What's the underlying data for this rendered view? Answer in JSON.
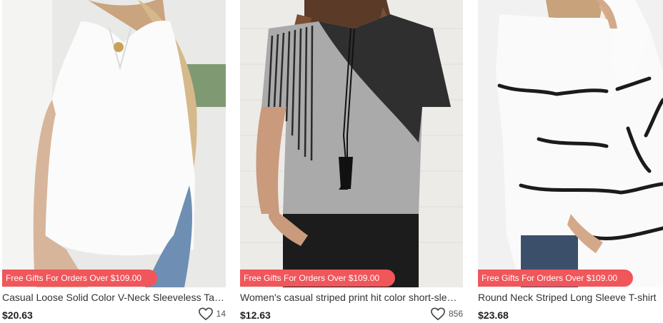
{
  "promo_text": "Free Gifts For Orders Over $109.00",
  "products": [
    {
      "title": "Casual Loose Solid Color V-Neck Sleeveless Tank Top",
      "price": "$20.63",
      "favorites": "14",
      "image_icon": "white-sleeveless-top-photo"
    },
    {
      "title": "Women's casual striped print hit color short-sleeve T-shirt",
      "price": "$12.63",
      "favorites": "856",
      "image_icon": "grey-black-colorblock-tee-photo"
    },
    {
      "title": "Round Neck Striped Long Sleeve T-shirt",
      "price": "$23.68",
      "favorites": "",
      "image_icon": "white-striped-sweatshirt-photo"
    }
  ],
  "colors": {
    "promo_badge": "#f0565a",
    "title_text": "#333333",
    "price_text": "#222222"
  }
}
